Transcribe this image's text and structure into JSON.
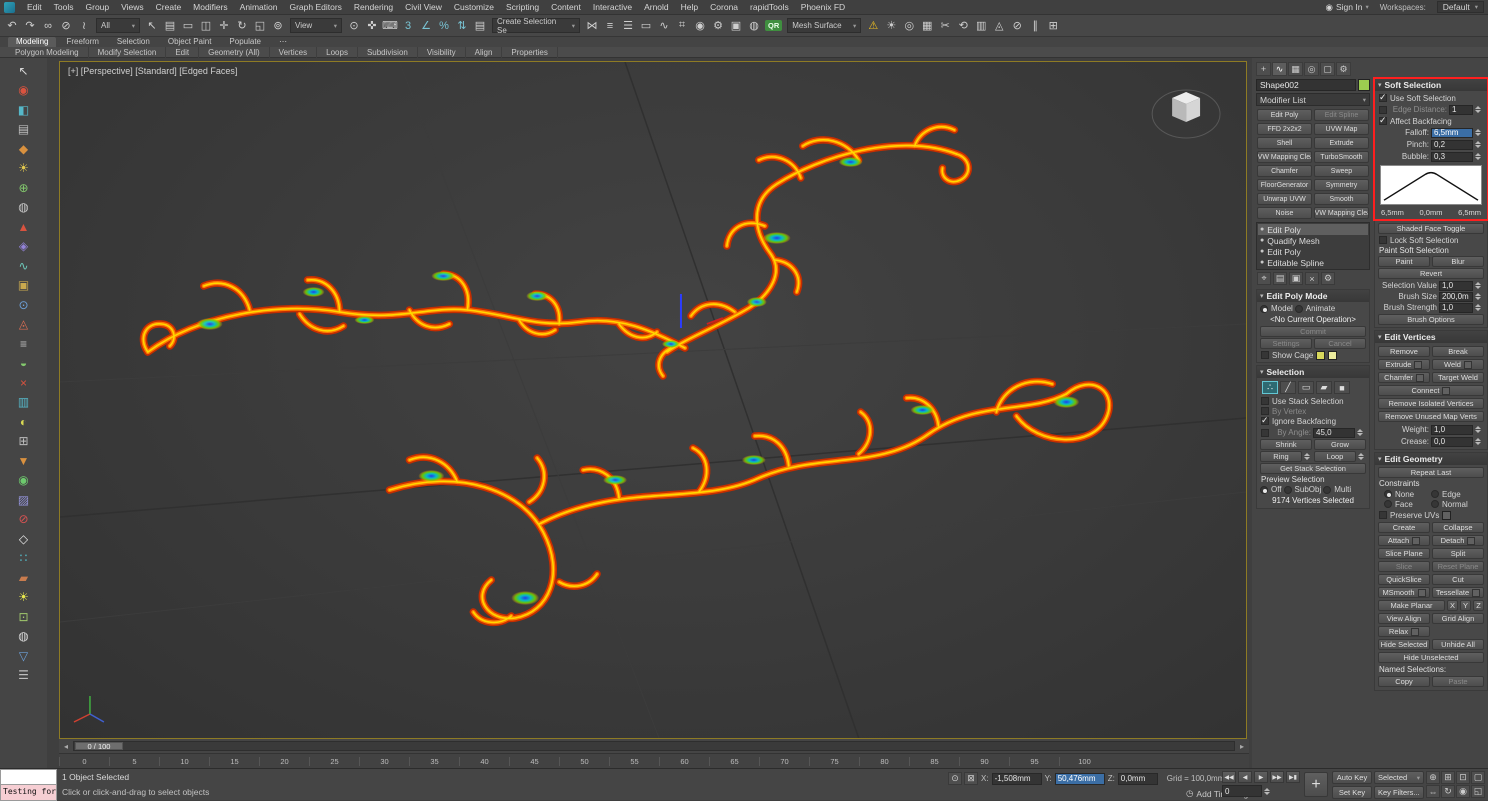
{
  "colors": {
    "object_swatch": "#9ccc50",
    "cage_swatch_1": "#d8d85c",
    "cage_swatch_2": "#ecec9e",
    "annotation": "#ff1f1f"
  },
  "menu": {
    "items": [
      "Edit",
      "Tools",
      "Group",
      "Views",
      "Create",
      "Modifiers",
      "Animation",
      "Graph Editors",
      "Rendering",
      "Civil View",
      "Customize",
      "Scripting",
      "Content",
      "Interactive",
      "Arnold",
      "Help",
      "Corona",
      "rapidTools",
      "Phoenix FD"
    ],
    "sign_in": "Sign In",
    "workspaces_label": "Workspaces:",
    "workspace_value": "Default"
  },
  "toolbar": {
    "icons_a": [
      {
        "g": "↶",
        "n": "undo-icon"
      },
      {
        "g": "↷",
        "n": "redo-icon"
      },
      {
        "g": "∞",
        "n": "select-link-icon"
      },
      {
        "g": "⊘",
        "n": "unlink-icon"
      },
      {
        "g": "≀",
        "n": "bind-spacewarp-icon"
      }
    ],
    "filter_value": "All",
    "icons_b": [
      {
        "g": "↖",
        "n": "select-object-icon"
      },
      {
        "g": "▤",
        "n": "select-by-name-icon"
      },
      {
        "g": "▭",
        "n": "region-select-icon"
      },
      {
        "g": "◫",
        "n": "window-crossing-icon"
      },
      {
        "g": "✛",
        "n": "select-move-icon"
      },
      {
        "g": "↻",
        "n": "select-rotate-icon"
      },
      {
        "g": "◱",
        "n": "select-scale-icon"
      },
      {
        "g": "⊚",
        "n": "select-placement-icon"
      }
    ],
    "ref_coord": "View",
    "icons_c": [
      {
        "g": "⊙",
        "n": "use-pivot-center-icon"
      },
      {
        "g": "✜",
        "n": "select-manipulate-icon"
      },
      {
        "g": "⌨",
        "n": "keyboard-override-icon"
      },
      {
        "g": "3",
        "n": "snap-toggle-icon",
        "c": "#79c4d4"
      },
      {
        "g": "∠",
        "n": "angle-snap-icon",
        "c": "#79c4d4"
      },
      {
        "g": "%",
        "n": "percent-snap-icon",
        "c": "#79c4d4"
      },
      {
        "g": "⇅",
        "n": "spinner-snap-icon",
        "c": "#79c4d4"
      },
      {
        "g": "▤",
        "n": "named-sets-icon"
      }
    ],
    "named_set": "Create Selection Se",
    "icons_d": [
      {
        "g": "⋈",
        "n": "mirror-icon"
      },
      {
        "g": "≡",
        "n": "align-icon"
      },
      {
        "g": "☰",
        "n": "layer-manager-icon"
      },
      {
        "g": "▭",
        "n": "ribbon-toggle-icon"
      },
      {
        "g": "∿",
        "n": "curve-editor-icon"
      },
      {
        "g": "⌗",
        "n": "schematic-view-icon"
      },
      {
        "g": "◉",
        "n": "material-editor-icon"
      },
      {
        "g": "⚙",
        "n": "render-setup-icon"
      },
      {
        "g": "▣",
        "n": "rendered-frame-icon"
      },
      {
        "g": "◍",
        "n": "render-icon"
      }
    ],
    "qr_label": "QR",
    "mesh_surface": "Mesh Surface",
    "icons_e": [
      {
        "g": "☀",
        "n": "light-icon"
      },
      {
        "g": "◎",
        "n": "camera-icon"
      },
      {
        "g": "▦",
        "n": "grid-helper-icon"
      },
      {
        "g": "✂",
        "n": "cut-tool-icon"
      },
      {
        "g": "⟲",
        "n": "toolbar-icon"
      },
      {
        "g": "▥",
        "n": "toolbar-icon"
      },
      {
        "g": "◬",
        "n": "toolbar-icon"
      },
      {
        "g": "⊘",
        "n": "toolbar-icon"
      },
      {
        "g": "∥",
        "n": "toolbar-icon"
      },
      {
        "g": "⊞",
        "n": "toolbar-icon"
      }
    ]
  },
  "ribbon": {
    "tabs": [
      {
        "label": "Modeling",
        "cls": "active"
      },
      {
        "label": "Freeform"
      },
      {
        "label": "Selection"
      },
      {
        "label": "Object Paint"
      },
      {
        "label": "Populate"
      },
      {
        "label": "⋯",
        "cls": "dim"
      }
    ],
    "panels": [
      "Polygon Modeling",
      "Modify Selection",
      "Edit",
      "Geometry (All)",
      "Vertices",
      "Loops",
      "Subdivision",
      "Visibility",
      "Align",
      "Properties"
    ]
  },
  "left_toolbar": {
    "icons": [
      {
        "g": "↖",
        "c": "#d8d8d8"
      },
      {
        "g": "◉",
        "c": "#d9533f"
      },
      {
        "g": "◧",
        "c": "#56b8c9"
      },
      {
        "g": "▤",
        "c": "#bdbdbd"
      },
      {
        "g": "◆",
        "c": "#d9913f"
      },
      {
        "g": "☀",
        "c": "#e3c94e"
      },
      {
        "g": "⊕",
        "c": "#83c96d"
      },
      {
        "g": "◍",
        "c": "#c9c9c9"
      },
      {
        "g": "▲",
        "c": "#d9533f"
      },
      {
        "g": "◈",
        "c": "#9383d9"
      },
      {
        "g": "∿",
        "c": "#6dc9ba"
      },
      {
        "g": "▣",
        "c": "#c9a94e"
      },
      {
        "g": "⊙",
        "c": "#6da1d9"
      },
      {
        "g": "◬",
        "c": "#d96d53"
      },
      {
        "g": "≡",
        "c": "#bdbdbd"
      },
      {
        "g": "◒",
        "c": "#83c96d"
      },
      {
        "g": "×",
        "c": "#d9533f"
      },
      {
        "g": "▥",
        "c": "#56b8c9"
      },
      {
        "g": "◐",
        "c": "#d9d953"
      },
      {
        "g": "⊞",
        "c": "#bdbdbd"
      },
      {
        "g": "▼",
        "c": "#d9913f"
      },
      {
        "g": "◉",
        "c": "#6dc96d"
      },
      {
        "g": "▨",
        "c": "#9393d9"
      },
      {
        "g": "⊘",
        "c": "#d95353"
      },
      {
        "g": "◇",
        "c": "#e8e8e8"
      },
      {
        "g": "∷",
        "c": "#56c3d1"
      },
      {
        "g": "▰",
        "c": "#c97c4e"
      },
      {
        "g": "☀",
        "c": "#e8e84e"
      },
      {
        "g": "⊡",
        "c": "#a1c96d"
      },
      {
        "g": "◍",
        "c": "#d9d9d9"
      },
      {
        "g": "▽",
        "c": "#6da1d9"
      },
      {
        "g": "☰",
        "c": "#bdbdbd"
      }
    ]
  },
  "viewport": {
    "label": "[+] [Perspective] [Standard] [Edged Faces]"
  },
  "timeline": {
    "slider_label": "0 / 100",
    "ticks": [
      "0",
      "5",
      "10",
      "15",
      "20",
      "25",
      "30",
      "35",
      "40",
      "45",
      "50",
      "55",
      "60",
      "65",
      "70",
      "75",
      "80",
      "85",
      "90",
      "95",
      "100"
    ]
  },
  "panel": {
    "tabs": [
      {
        "g": "+",
        "n": "create-tab"
      },
      {
        "g": "∿",
        "n": "modify-tab",
        "cls": "active"
      },
      {
        "g": "▦",
        "n": "hierarchy-tab"
      },
      {
        "g": "◎",
        "n": "motion-tab"
      },
      {
        "g": "▢",
        "n": "display-tab"
      },
      {
        "g": "⚙",
        "n": "utilities-tab"
      }
    ],
    "object_name": "Shape002",
    "modifier_list_label": "Modifier List",
    "modifier_buttons": [
      {
        "label": "Edit Poly"
      },
      {
        "label": "Edit Spline",
        "cls": "disabled"
      },
      {
        "label": "FFD 2x2x2"
      },
      {
        "label": "UVW Map"
      },
      {
        "label": "Shell"
      },
      {
        "label": "Extrude"
      },
      {
        "label": "UVW Mapping Clear"
      },
      {
        "label": "TurboSmooth"
      },
      {
        "label": "Chamfer"
      },
      {
        "label": "Sweep"
      },
      {
        "label": "FloorGenerator"
      },
      {
        "label": "Symmetry"
      },
      {
        "label": "Unwrap UVW"
      },
      {
        "label": "Smooth"
      },
      {
        "label": "Noise"
      },
      {
        "label": "UVW Mapping Clear"
      }
    ],
    "stack": [
      {
        "label": "Edit Poly",
        "cls": "selected"
      },
      {
        "label": "Quadify Mesh"
      },
      {
        "label": "Edit Poly"
      },
      {
        "label": "Editable Spline"
      }
    ],
    "stack_tools": [
      {
        "g": "⌖",
        "n": "pin-stack-icon"
      },
      {
        "g": "▤",
        "n": "show-end-result-icon"
      },
      {
        "g": "▣",
        "n": "make-unique-icon"
      },
      {
        "g": "×",
        "n": "remove-modifier-icon"
      },
      {
        "g": "⚙",
        "n": "configure-modifier-sets-icon"
      }
    ],
    "edit_poly_mode": {
      "title": "Edit Poly Mode",
      "model_label": "Model",
      "animate_label": "Animate",
      "operation": "<No Current Operation>",
      "commit_label": "Commit",
      "settings_label": "Settings",
      "cancel_label": "Cancel",
      "show_cage_label": "Show Cage"
    },
    "selection": {
      "title": "Selection",
      "subobj": [
        {
          "g": "∴",
          "n": "vertex-mode-icon",
          "cls": "active"
        },
        {
          "g": "╱",
          "n": "edge-mode-icon"
        },
        {
          "g": "▭",
          "n": "border-mode-icon"
        },
        {
          "g": "▰",
          "n": "polygon-mode-icon"
        },
        {
          "g": "■",
          "n": "element-mode-icon"
        }
      ],
      "checks": [
        {
          "label": "Use Stack Selection"
        },
        {
          "label": "By Vertex",
          "cls": "disabled"
        },
        {
          "label": "Ignore Backfacing",
          "cls": "checked"
        }
      ],
      "by_angle_label": "By Angle:",
      "by_angle_value": "45,0",
      "shrink_label": "Shrink",
      "grow_label": "Grow",
      "ring_label": "Ring",
      "loop_label": "Loop",
      "get_stack_label": "Get Stack Selection",
      "preview_label": "Preview Selection",
      "preview": [
        {
          "label": "Off",
          "cls": "on"
        },
        {
          "label": "SubObj"
        },
        {
          "label": "Multi"
        }
      ],
      "status": "9174 Vertices Selected"
    },
    "soft_selection": {
      "title": "Soft Selection",
      "use_label": "Use Soft Selection",
      "edge_distance_label": "Edge Distance:",
      "edge_distance_value": "1",
      "affect_label": "Affect Backfacing",
      "falloff": {
        "label": "Falloff:",
        "value": "6,5mm"
      },
      "pinch": {
        "label": "Pinch:",
        "value": "0,2"
      },
      "bubble": {
        "label": "Bubble:",
        "value": "0,3"
      },
      "curve_labels": [
        "6,5mm",
        "0,0mm",
        "6,5mm"
      ],
      "shaded_label": "Shaded Face Toggle",
      "lock_label": "Lock Soft Selection",
      "paint_label": "Paint Soft Selection",
      "paint": "Paint",
      "blur": "Blur",
      "revert": "Revert",
      "rows": [
        {
          "label": "Selection Value",
          "value": "1,0"
        },
        {
          "label": "Brush Size",
          "value": "200,0m"
        },
        {
          "label": "Brush Strength",
          "value": "1,0"
        }
      ],
      "brush_options": "Brush Options"
    },
    "edit_vertices": {
      "title": "Edit Vertices",
      "buttons": [
        {
          "label": "Remove"
        },
        {
          "label": "Break"
        },
        {
          "label": "Extrude",
          "cls": "hasbox"
        },
        {
          "label": "Weld",
          "cls": "hasbox"
        },
        {
          "label": "Chamfer",
          "cls": "hasbox"
        },
        {
          "label": "Target Weld"
        },
        {
          "label": "Connect",
          "cls": "hasbox full"
        },
        {
          "label": "Remove Isolated Vertices",
          "cls": "full"
        },
        {
          "label": "Remove Unused Map Verts",
          "cls": "full"
        }
      ],
      "weight": {
        "label": "Weight:",
        "value": "1,0"
      },
      "crease": {
        "label": "Crease:",
        "value": "0,0"
      }
    },
    "edit_geometry": {
      "title": "Edit Geometry",
      "repeat_label": "Repeat Last",
      "constraints_label": "Constraints",
      "constraints": [
        {
          "label": "None",
          "cls": "on"
        },
        {
          "label": "Edge"
        },
        {
          "label": "Face"
        },
        {
          "label": "Normal"
        }
      ],
      "preserve_label": "Preserve UVs",
      "buttons": [
        {
          "label": "Create"
        },
        {
          "label": "Collapse"
        },
        {
          "label": "Attach",
          "cls": "hasbox"
        },
        {
          "label": "Detach",
          "cls": "hasbox"
        },
        {
          "label": "Slice Plane"
        },
        {
          "label": "Split"
        },
        {
          "label": "Slice",
          "cls": "disabled"
        },
        {
          "label": "Reset Plane",
          "cls": "disabled"
        },
        {
          "label": "QuickSlice"
        },
        {
          "label": "Cut"
        },
        {
          "label": "MSmooth",
          "cls": "hasbox"
        },
        {
          "label": "Tessellate",
          "cls": "hasbox"
        },
        {
          "label": "Make Planar",
          "cls": "mp"
        },
        {
          "label": "X",
          "cls": "xs"
        },
        {
          "label": "Y",
          "cls": "xs"
        },
        {
          "label": "Z",
          "cls": "xs"
        },
        {
          "label": "View Align"
        },
        {
          "label": "Grid Align"
        },
        {
          "label": "Relax",
          "cls": "hasbox solo"
        },
        {
          "label": "Hide Selected"
        },
        {
          "label": "Unhide All"
        },
        {
          "label": "Hide Unselected",
          "cls": "full"
        }
      ],
      "named_label": "Named Selections:",
      "named": [
        {
          "label": "Copy"
        },
        {
          "label": "Paste",
          "cls": "disabled"
        }
      ]
    }
  },
  "status": {
    "listener_text": "Testing for :",
    "selected_text": "1 Object Selected",
    "prompt": "Click or click-and-drag to select objects",
    "x_label": "X:",
    "x_value": "-1,508mm",
    "y_label": "Y:",
    "y_value": "50,476mm",
    "z_label": "Z:",
    "z_value": "0,0mm",
    "grid_text": "Grid = 100,0mm",
    "time_tag": "Add Time Tag",
    "auto_key": "Auto Key",
    "selected_dd": "Selected",
    "set_key": "Set Key",
    "key_filters": "Key Filters...",
    "frame": "0",
    "transport": [
      {
        "g": "◀◀",
        "n": "go-to-start-icon"
      },
      {
        "g": "◀",
        "n": "previous-frame-icon"
      },
      {
        "g": "▶",
        "n": "play-icon"
      },
      {
        "g": "▶▶",
        "n": "next-frame-icon"
      },
      {
        "g": "▶▮",
        "n": "go-to-end-icon"
      }
    ],
    "nav": [
      {
        "g": "⊕",
        "n": "zoom-icon"
      },
      {
        "g": "⊞",
        "n": "zoom-all-icon"
      },
      {
        "g": "⊡",
        "n": "zoom-extents-icon"
      },
      {
        "g": "▢",
        "n": "zoom-extents-all-icon"
      },
      {
        "g": "⇔",
        "n": "pan-icon"
      },
      {
        "g": "↻",
        "n": "orbit-icon"
      },
      {
        "g": "◉",
        "n": "field-of-view-icon"
      },
      {
        "g": "◱",
        "n": "maximize-viewport-icon"
      }
    ]
  }
}
